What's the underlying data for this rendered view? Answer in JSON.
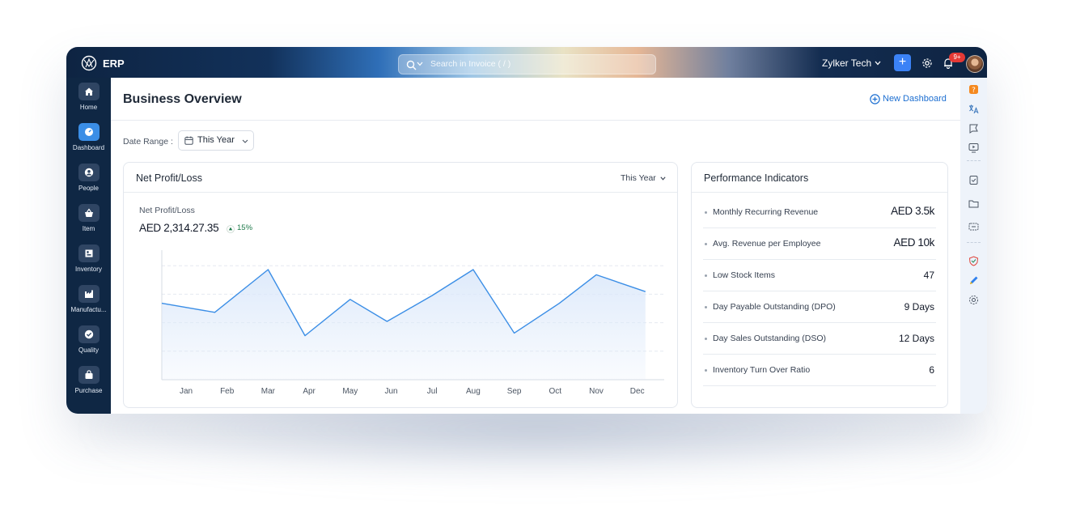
{
  "app": {
    "brand": "ERP"
  },
  "topbar": {
    "search_placeholder": "Search in Invoice ( / )",
    "organization": "Zylker Tech",
    "add_label": "+",
    "notifications_badge": "9+"
  },
  "sidebar": {
    "items": [
      {
        "label": "Home",
        "icon": "home-icon"
      },
      {
        "label": "Dashboard",
        "icon": "dashboard-icon",
        "active": true
      },
      {
        "label": "People",
        "icon": "people-icon"
      },
      {
        "label": "Item",
        "icon": "item-icon"
      },
      {
        "label": "Inventory",
        "icon": "inventory-icon"
      },
      {
        "label": "Manufactu...",
        "icon": "manufacturing-icon"
      },
      {
        "label": "Quality",
        "icon": "quality-icon"
      },
      {
        "label": "Purchase",
        "icon": "purchase-icon"
      }
    ]
  },
  "page": {
    "title": "Business Overview",
    "new_dashboard": "New Dashboard",
    "date_range_label": "Date Range :",
    "date_range_value": "This Year"
  },
  "profit_card": {
    "title": "Net Profit/Loss",
    "period": "This Year",
    "metric_label": "Net Profit/Loss",
    "metric_value": "AED 2,314.27.35",
    "trend": "15%",
    "trend_color": "#1f7a4b"
  },
  "chart_data": {
    "type": "area",
    "categories": [
      "Jan",
      "Feb",
      "Mar",
      "Apr",
      "May",
      "Jun",
      "Jul",
      "Aug",
      "Sep",
      "Oct",
      "Nov",
      "Dec"
    ],
    "x_points": [
      0.5,
      1.7,
      3.0,
      3.9,
      5.0,
      5.9,
      7.0,
      8.0,
      9.0,
      10.1,
      11.0,
      12.2
    ],
    "values": [
      59,
      52,
      85,
      34,
      62,
      45,
      65,
      85,
      36,
      59,
      81,
      68
    ],
    "ylim": [
      0,
      100
    ],
    "line_color": "#3b8ee6",
    "fill_color": "#dbe8fa",
    "grid": "horizontal dashed"
  },
  "performance": {
    "title": "Performance Indicators",
    "rows": [
      {
        "name": "Monthly Recurring Revenue",
        "value": "AED 3.5k",
        "big": true
      },
      {
        "name": "Avg. Revenue per Employee",
        "value": "AED 10k",
        "big": true
      },
      {
        "name": "Low Stock Items",
        "value": "47"
      },
      {
        "name": "Day Payable Outstanding (DPO)",
        "value": "9 Days"
      },
      {
        "name": "Day Sales Outstanding (DSO)",
        "value": "12 Days"
      },
      {
        "name": "Inventory Turn Over Ratio",
        "value": "6"
      }
    ]
  },
  "rail": {
    "icons": [
      "help-icon",
      "translate-icon",
      "feedback-icon",
      "video-icon",
      "checklist-icon",
      "folder-icon",
      "chat-icon",
      "shield-icon",
      "pencil-icon",
      "settings-icon"
    ]
  }
}
